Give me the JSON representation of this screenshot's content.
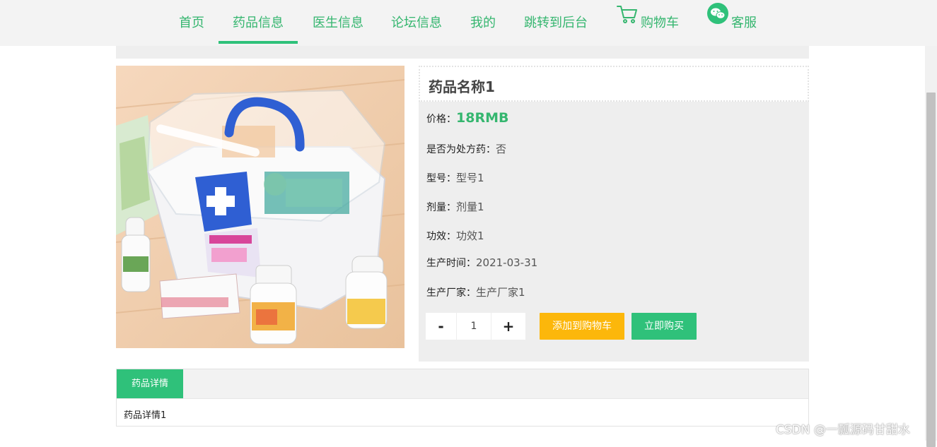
{
  "nav": {
    "home": "首页",
    "medicine": "药品信息",
    "doctor": "医生信息",
    "forum": "论坛信息",
    "mine": "我的",
    "backend": "跳转到后台",
    "cart": "购物车",
    "service": "客服"
  },
  "product": {
    "name": "药品名称1",
    "price_label": "价格：",
    "price_value": "18RMB",
    "prescription_label": "是否为处方药：",
    "prescription_value": "否",
    "model_label": "型号：",
    "model_value": "型号1",
    "dosage_label": "剂量：",
    "dosage_value": "剂量1",
    "effect_label": "功效：",
    "effect_value": "功效1",
    "date_label": "生产时间：",
    "date_value": "2021-03-31",
    "maker_label": "生产厂家：",
    "maker_value": "生产厂家1"
  },
  "quantity": {
    "minus": "-",
    "value": "1",
    "plus": "+"
  },
  "buttons": {
    "add_to_cart": "添加到购物车",
    "buy_now": "立即购买"
  },
  "details": {
    "tab_label": "药品详情",
    "content": "药品详情1"
  },
  "watermark": "CSDN @一瓢源码甘甜水",
  "colors": {
    "accent": "#2fc17a",
    "cart_button": "#fcb70b",
    "nav_text": "#35b66f"
  },
  "icons": {
    "cart": "cart-icon",
    "service": "wechat-icon"
  }
}
